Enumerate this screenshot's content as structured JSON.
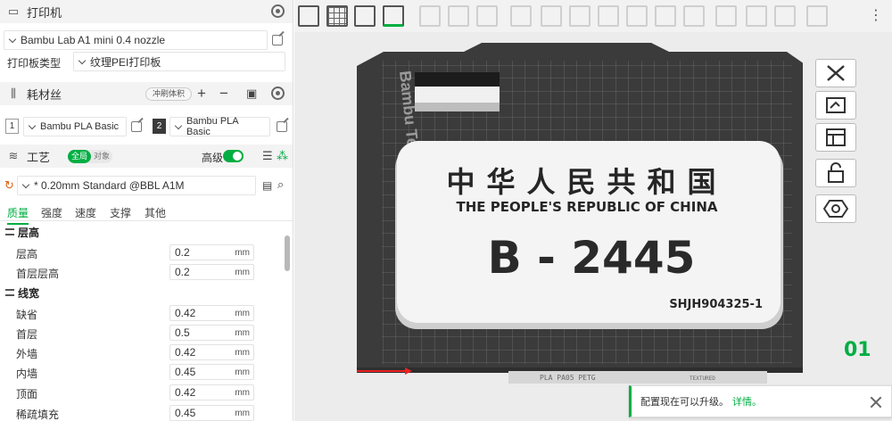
{
  "printer": {
    "section_title": "打印机",
    "preset": "Bambu Lab A1 mini 0.4 nozzle",
    "plate_type_label": "打印板类型",
    "plate_type_value": "纹理PEI打印板"
  },
  "filament": {
    "section_title": "耗材丝",
    "flush_label": "冲刷体积",
    "slots": [
      {
        "index": "1",
        "name": "Bambu PLA Basic"
      },
      {
        "index": "2",
        "name": "Bambu PLA Basic"
      }
    ]
  },
  "process": {
    "section_title": "工艺",
    "global_label": "全局",
    "object_label": "对象",
    "advanced_label": "高级",
    "preset": "* 0.20mm Standard @BBL A1M",
    "tabs": [
      "质量",
      "强度",
      "速度",
      "支撑",
      "其他"
    ],
    "groups": [
      {
        "title": "层高",
        "rows": [
          {
            "label": "层高",
            "value": "0.2",
            "unit": "mm"
          },
          {
            "label": "首层层高",
            "value": "0.2",
            "unit": "mm"
          }
        ]
      },
      {
        "title": "线宽",
        "rows": [
          {
            "label": "缺省",
            "value": "0.42",
            "unit": "mm"
          },
          {
            "label": "首层",
            "value": "0.5",
            "unit": "mm"
          },
          {
            "label": "外墙",
            "value": "0.42",
            "unit": "mm"
          },
          {
            "label": "内墙",
            "value": "0.45",
            "unit": "mm"
          },
          {
            "label": "顶面",
            "value": "0.42",
            "unit": "mm"
          },
          {
            "label": "稀疏填充",
            "value": "0.45",
            "unit": "mm"
          }
        ]
      }
    ]
  },
  "viewport": {
    "bed_label": "Bambu Textured PEI Plate",
    "bed_bottom_label": "PLA PA05 PETG",
    "bed_textured_label": "TEXTURED",
    "plate_number": "01",
    "model": {
      "title_cn": "中华人民共和国",
      "title_en": "THE PEOPLE'S REPUBLIC OF CHINA",
      "code": "B - 2445",
      "serial": "SHJH904325-1"
    }
  },
  "notification": {
    "text": "配置现在可以升级。",
    "link": "详情。"
  },
  "colors": {
    "accent": "#00ae42",
    "bed": "#3d3d3d",
    "model_plate": "#f4f4f4",
    "model_text": "#2a2a2a"
  }
}
